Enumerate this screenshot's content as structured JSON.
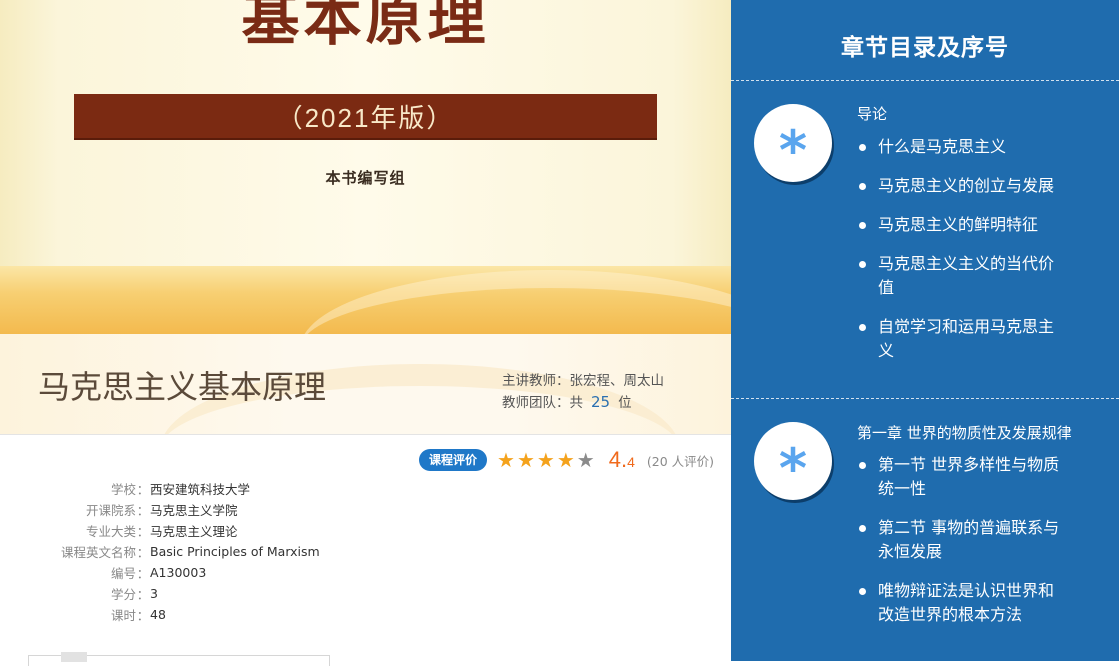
{
  "cover": {
    "title": "基本原理",
    "edition": "（2021年版）",
    "author": "本书编写组"
  },
  "course": {
    "title": "马克思主义基本原理",
    "teacher_label": "主讲教师：",
    "teacher_value": "张宏程、周太山",
    "team_label": "教师团队：共",
    "team_count": "25",
    "team_unit": "位"
  },
  "rating": {
    "badge": "课程评价",
    "stars": [
      "star-full",
      "star-full",
      "star-full",
      "star-full",
      "star-empty"
    ],
    "score_main": "4.",
    "score_decimal": "4",
    "review_count": "(20 人评价)",
    "colors": {
      "badge": "#1f78c8",
      "star": "#f4a21c",
      "score": "#f06a1c"
    }
  },
  "info": [
    {
      "label": "学校",
      "value": "西安建筑科技大学"
    },
    {
      "label": "开课院系",
      "value": "马克思主义学院"
    },
    {
      "label": "专业大类",
      "value": "马克思主义理论"
    },
    {
      "label": "课程英文名称",
      "value": "Basic Principles of Marxism"
    },
    {
      "label": "编号",
      "value": "A130003"
    },
    {
      "label": "学分",
      "value": "3"
    },
    {
      "label": "课时",
      "value": "48"
    }
  ],
  "panel": {
    "title": "章节目录及序号",
    "accent": "#1f6cae",
    "sections": [
      {
        "icon": "asterisk-icon",
        "heading": "导论",
        "items": [
          "什么是马克思主义",
          "马克思主义的创立与发展",
          "马克思主义的鲜明特征",
          "马克思主义主义的当代价值",
          "自觉学习和运用马克思主义"
        ]
      },
      {
        "icon": "asterisk-icon",
        "heading": "第一章 世界的物质性及发展规律",
        "items": [
          "第一节 世界多样性与物质统一性",
          "第二节 事物的普遍联系与永恒发展",
          "唯物辩证法是认识世界和改造世界的根本方法"
        ]
      }
    ]
  }
}
